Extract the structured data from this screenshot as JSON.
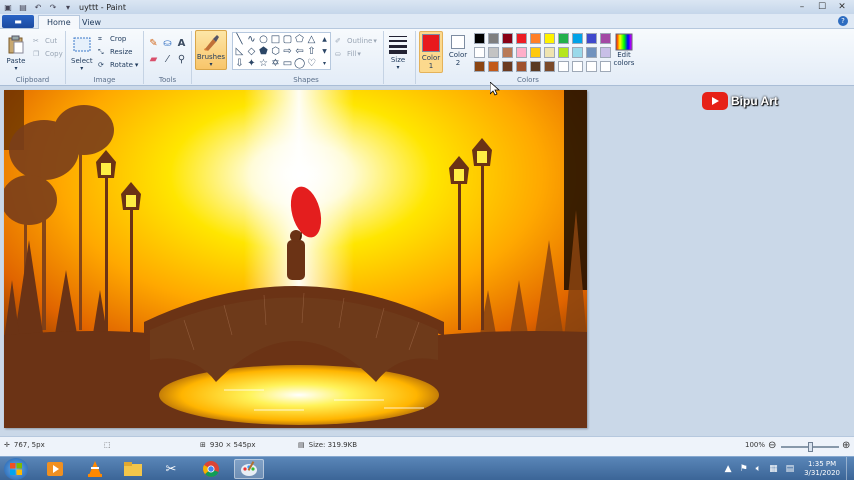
{
  "window": {
    "title": "uyttt - Paint",
    "controls": [
      "minimize-icon",
      "maximize-icon",
      "close-icon"
    ]
  },
  "tabs": {
    "file_label": "▬",
    "home": "Home",
    "view": "View"
  },
  "ribbon": {
    "clipboard": {
      "label": "Clipboard",
      "paste": "Paste",
      "cut": "Cut",
      "copy": "Copy"
    },
    "image": {
      "label": "Image",
      "select": "Select",
      "crop": "Crop",
      "resize": "Resize",
      "rotate": "Rotate"
    },
    "tools": {
      "label": "Tools"
    },
    "brushes": "Brushes",
    "shapes": {
      "label": "Shapes",
      "outline": "Outline",
      "fill": "Fill"
    },
    "size": "Size",
    "colors": {
      "label": "Colors",
      "color1": "Color\n1",
      "color2": "Color\n2",
      "color1_value": "#e8191c",
      "color2_value": "#ffffff",
      "edit": "Edit\ncolors",
      "palette": [
        "#000000",
        "#7f7f7f",
        "#880015",
        "#ed1c24",
        "#ff7f27",
        "#fff200",
        "#22b14c",
        "#00a2e8",
        "#3f48cc",
        "#a349a4",
        "#ffffff",
        "#c3c3c3",
        "#b97a57",
        "#ffaec9",
        "#ffc90e",
        "#efe4b0",
        "#b5e61d",
        "#99d9ea",
        "#7092be",
        "#c8bfe7",
        "#8b4513",
        "#c25a1a",
        "#6b3a20",
        "#a0522d",
        "#5a3a22",
        "#7a4a2a",
        "#ffffff",
        "#ffffff",
        "#ffffff",
        "#ffffff"
      ]
    }
  },
  "overlay": {
    "channel": "Bipu Art"
  },
  "status": {
    "cursor_pos": "767, 5px",
    "image_size": "930 × 545px",
    "file_size": "Size: 319.9KB",
    "zoom": "100%"
  },
  "taskbar": {
    "time": "1:35 PM",
    "date": "3/31/2020",
    "apps": [
      "media-player-icon",
      "vlc-icon",
      "file-explorer-icon",
      "snipping-tool-icon",
      "chrome-icon",
      "paint-icon"
    ]
  }
}
